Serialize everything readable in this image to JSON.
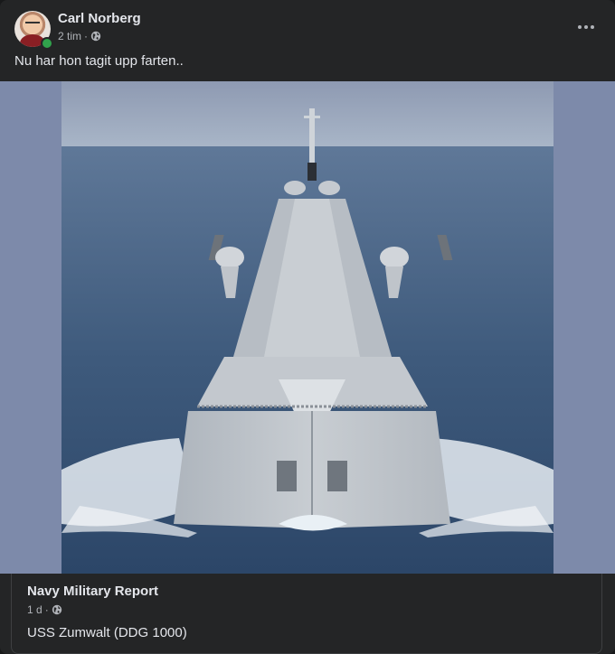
{
  "post": {
    "author": "Carl Norberg",
    "time": "2 tim",
    "separator": "·",
    "privacy_icon": "globe-icon",
    "caption": "Nu har hon tagit upp farten..",
    "more_icon": "more-options-icon"
  },
  "shared": {
    "author": "Navy Military Report",
    "time": "1 d",
    "separator": "·",
    "privacy_icon": "globe-icon",
    "text": "USS Zumwalt (DDG 1000)"
  },
  "colors": {
    "card_bg": "#242526",
    "text_primary": "#e4e6eb",
    "text_secondary": "#b0b3b8",
    "online": "#31a24c"
  }
}
